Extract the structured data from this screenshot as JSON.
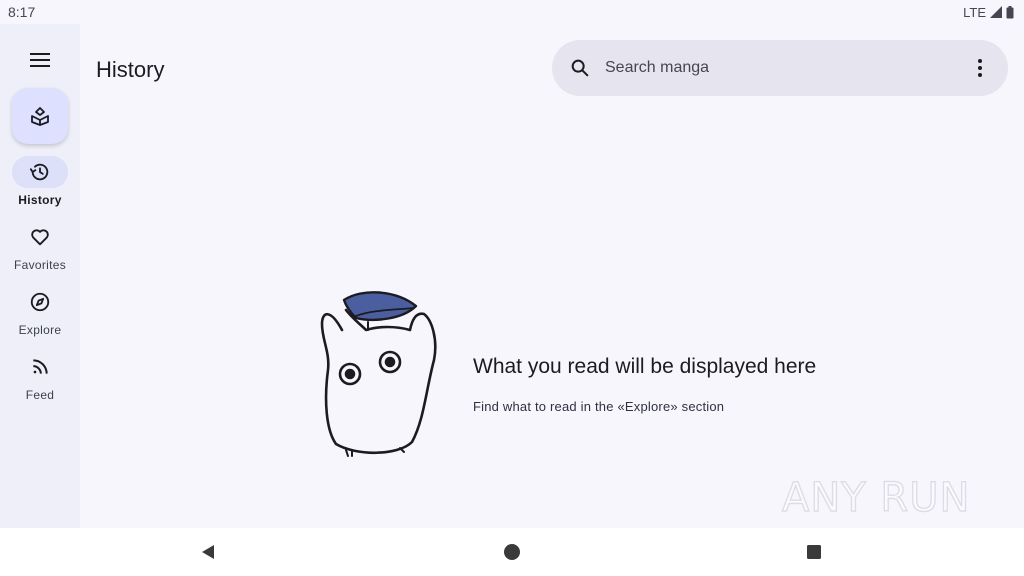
{
  "status_bar": {
    "time": "8:17",
    "network": "LTE"
  },
  "nav_rail": {
    "items": [
      {
        "label": "History",
        "icon": "history-icon",
        "active": true
      },
      {
        "label": "Favorites",
        "icon": "heart-icon",
        "active": false
      },
      {
        "label": "Explore",
        "icon": "compass-icon",
        "active": false
      },
      {
        "label": "Feed",
        "icon": "rss-icon",
        "active": false
      }
    ]
  },
  "header": {
    "title": "History"
  },
  "search": {
    "placeholder": "Search manga"
  },
  "empty_state": {
    "title": "What you read will be displayed here",
    "subtitle": "Find what to read in the «Explore» section"
  },
  "watermark": {
    "text": "ANY RUN"
  },
  "colors": {
    "accent": "#dde1ff",
    "leaf": "#4b5fa0",
    "rail_bg": "#eeeff9",
    "search_bg": "#e5e4ef"
  }
}
